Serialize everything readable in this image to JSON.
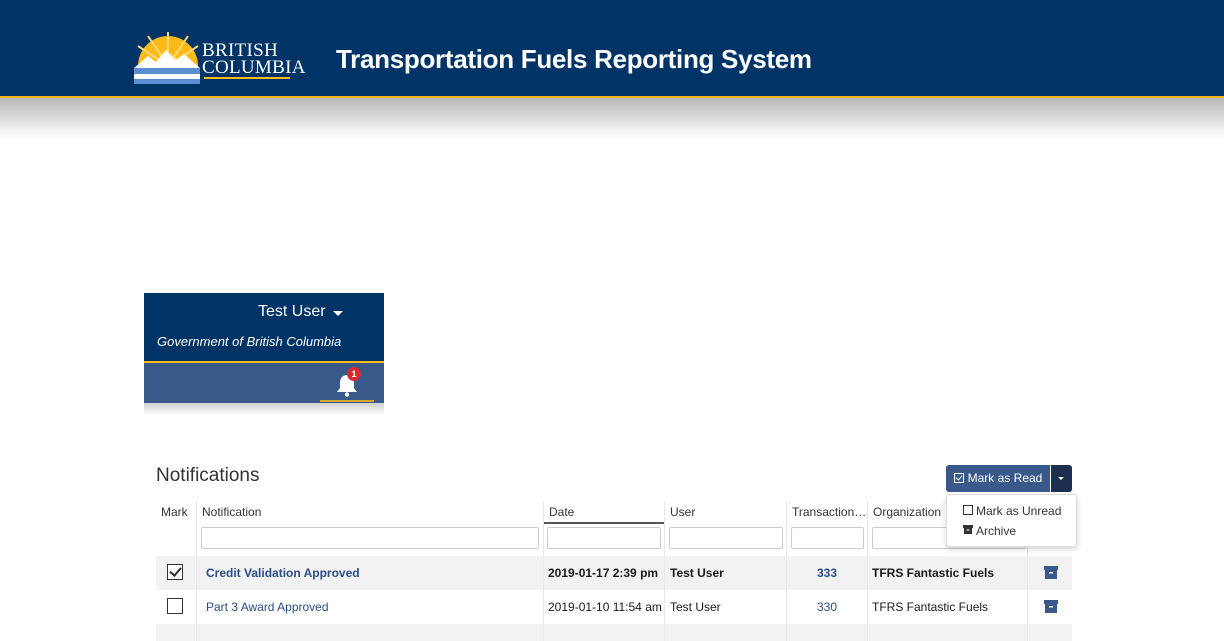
{
  "header": {
    "logo_line1": "BRITISH",
    "logo_line2": "COLUMBIA",
    "app_title": "Transportation Fuels Reporting System",
    "bg_color": "#003366",
    "accent_color": "#fcba19"
  },
  "user_panel": {
    "user_name": "Test User",
    "gov_text": "Government of British Columbia",
    "notification_count": "1"
  },
  "notifications": {
    "title": "Notifications",
    "mark_read_label": "Mark as Read",
    "menu": {
      "mark_unread": "Mark as Unread",
      "archive": "Archive"
    },
    "columns": [
      "Mark",
      "Notification",
      "Date",
      "User",
      "Transaction…",
      "Organization"
    ],
    "rows": [
      {
        "checked": true,
        "notification": "Credit Validation Approved",
        "date": "2019-01-17 2:39 pm",
        "user": "Test User",
        "transaction": "333",
        "organization": "TFRS Fantastic Fuels",
        "unread": true
      },
      {
        "checked": false,
        "notification": "Part 3 Award Approved",
        "date": "2019-01-10 11:54 am",
        "user": "Test User",
        "transaction": "330",
        "organization": "TFRS Fantastic Fuels",
        "unread": false
      }
    ]
  }
}
